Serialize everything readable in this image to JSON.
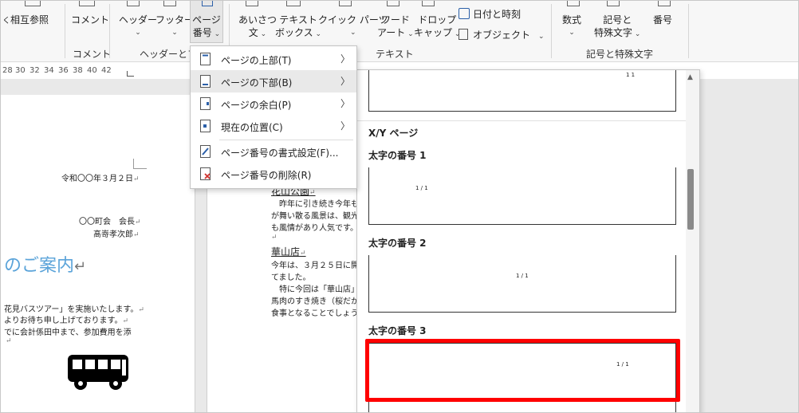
{
  "ribbon": {
    "cross_ref": "相互参照",
    "comment_btn": "コメント",
    "comment_group": "コメント",
    "header_btn": "ヘッダー",
    "footer_btn": "フッター",
    "page_number_btn_l1": "ページ",
    "page_number_btn_l2": "番号",
    "header_footer_group": "ヘッダーとフッ",
    "greeting_l1": "あいさつ",
    "greeting_l2": "文",
    "textbox_l1": "テキスト",
    "textbox_l2": "ボックス",
    "quickparts": "クイック パーツ",
    "wordart_l1": "ワード",
    "wordart_l2": "アート",
    "dropcap_l1": "ドロップ",
    "dropcap_l2": "キャップ",
    "datetime": "日付と時刻",
    "object": "オブジェクト",
    "text_group": "テキスト",
    "equation": "数式",
    "symbol_l1": "記号と",
    "symbol_l2": "特殊文字",
    "number_btn": "番号",
    "symbols_group": "記号と特殊文字"
  },
  "ruler": {
    "ticks": [
      "28",
      "30",
      "32",
      "34",
      "36",
      "38",
      "40",
      "42"
    ]
  },
  "menu": {
    "items": [
      {
        "label": "ページの上部(T)"
      },
      {
        "label": "ページの下部(B)"
      },
      {
        "label": "ページの余白(P)"
      },
      {
        "label": "現在の位置(C)"
      },
      {
        "label": "ページ番号の書式設定(F)..."
      },
      {
        "label": "ページ番号の削除(R)"
      }
    ]
  },
  "document": {
    "date": "令和〇〇年３月２日",
    "sender1": "〇〇町会　会長",
    "sender2": "髙嵜孝次郎",
    "title_fragment": "のご案内",
    "body1": "花見バスツアー」を実施いたします。",
    "body2": "よりお待ち申し上げております。",
    "body3": "でに会計係田中まで、参加費用を添",
    "p2_heading1": "花山公園",
    "p2_line1": "　昨年に引き続き今年も",
    "p2_line2": "が舞い散る風景は、観光",
    "p2_line3": "も風情があり人気です。",
    "p2_heading2": "華山店",
    "p2_line4": "今年は、３月２５日に開",
    "p2_line5": "てました。",
    "p2_line6": "　特に今回は「華山店」の",
    "p2_line7": "馬肉のすき焼き（桜だか",
    "p2_line8": "食事となることでしょう"
  },
  "gallery": {
    "section_label": "X/Y ページ",
    "item1_label": "太字の番号 1",
    "item2_label": "太字の番号 2",
    "item3_label": "太字の番号 3",
    "page_fraction": "1 / 1",
    "top_num": "1 1"
  },
  "colors": {
    "highlight_red": "#ff0000",
    "title_blue": "#5aa3d9"
  },
  "icons": {
    "bus": "bus-icon",
    "page": "page-icon"
  }
}
